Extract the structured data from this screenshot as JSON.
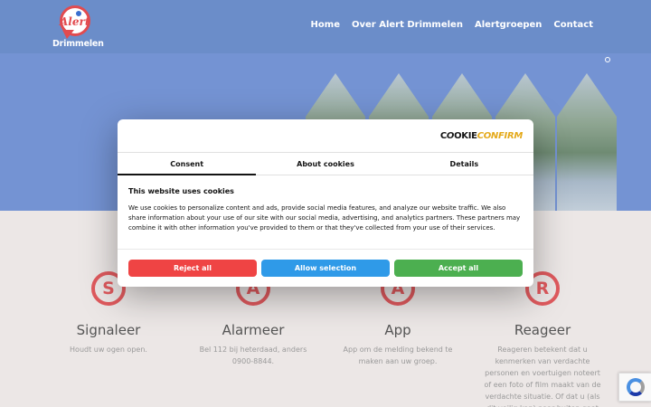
{
  "header": {
    "logo_text": "Alert",
    "logo_town": "Drimmelen",
    "nav": [
      "Home",
      "Over Alert Drimmelen",
      "Alertgroepen",
      "Contact"
    ]
  },
  "features": [
    {
      "letter": "S",
      "title": "Signaleer",
      "text": "Houdt uw ogen open."
    },
    {
      "letter": "A",
      "title": "Alarmeer",
      "text": "Bel 112 bij heterdaad, anders 0900-8844."
    },
    {
      "letter": "A",
      "title": "App",
      "text": "App om de melding bekend te maken aan uw groep."
    },
    {
      "letter": "R",
      "title": "Reageer",
      "text": "Reageren betekent dat u kenmerken van verdachte personen en voertuigen noteert of een foto of film maakt van de verdachte situatie. Of dat u (als dit veilig kan) naar buiten gaat en een"
    }
  ],
  "cookie": {
    "brand_prefix": "C",
    "brand_o": "O",
    "brand_mid": "OKIE",
    "brand_suffix": "CONFIRM",
    "tabs": [
      "Consent",
      "About cookies",
      "Details"
    ],
    "title": "This website uses cookies",
    "body": "We use cookies to personalize content and ads, provide social media features, and analyze our website traffic. We also share information about your use of our site with our social media, advertising, and analytics partners. These partners may combine it with other information you've provided to them or that they've collected from your use of their services.",
    "reject_label": "Reject all",
    "allow_label": "Allow selection",
    "accept_label": "Accept all"
  },
  "colors": {
    "header": "#6b8dc9",
    "accent_red": "#e05a5e",
    "reject": "#ef4444",
    "allow": "#2f9ae8",
    "accept": "#4caf50"
  }
}
